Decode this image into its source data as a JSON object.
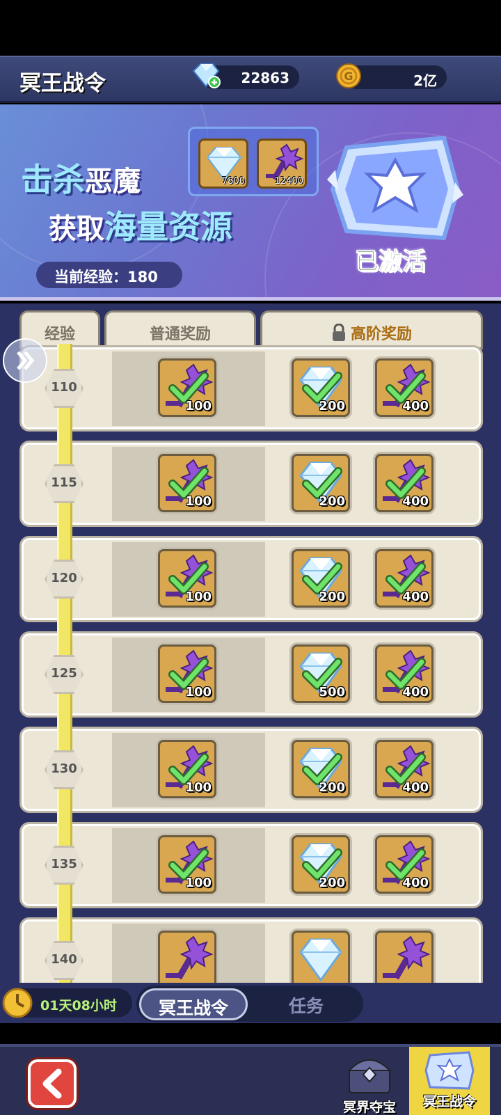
{
  "header": {
    "title": "冥王战令",
    "gems": "22863",
    "gold": "2亿"
  },
  "banner": {
    "line1_a": "击杀",
    "line1_b": "恶魔",
    "line2_a": "获取",
    "line2_b": "海量资源",
    "exp_label": "当前经验：180",
    "preview_items": [
      {
        "icon": "diamond-icon",
        "count": "7800"
      },
      {
        "icon": "dark-key-icon",
        "count": "12400"
      }
    ],
    "status": "已激活"
  },
  "tabs": {
    "exp": "经验",
    "normal": "普通奖励",
    "premium": "高阶奖励"
  },
  "rows": [
    {
      "level": "110",
      "normal": "100",
      "premium_a": "200",
      "premium_b": "400"
    },
    {
      "level": "115",
      "normal": "100",
      "premium_a": "200",
      "premium_b": "400"
    },
    {
      "level": "120",
      "normal": "100",
      "premium_a": "200",
      "premium_b": "400"
    },
    {
      "level": "125",
      "normal": "100",
      "premium_a": "500",
      "premium_b": "400"
    },
    {
      "level": "130",
      "normal": "100",
      "premium_a": "200",
      "premium_b": "400"
    },
    {
      "level": "135",
      "normal": "100",
      "premium_a": "200",
      "premium_b": "400"
    },
    {
      "level": "140",
      "normal": "",
      "premium_a": "",
      "premium_b": ""
    }
  ],
  "nav": {
    "timer": "01天08小时",
    "tab_pass": "冥王战令",
    "tab_tasks": "任务"
  },
  "footer": {
    "treasure": "冥界夺宝",
    "pass": "冥王战令"
  },
  "colors": {
    "accent_gold": "#f0d542",
    "check_green": "#4fd84f",
    "panel": "#ece6d6"
  }
}
